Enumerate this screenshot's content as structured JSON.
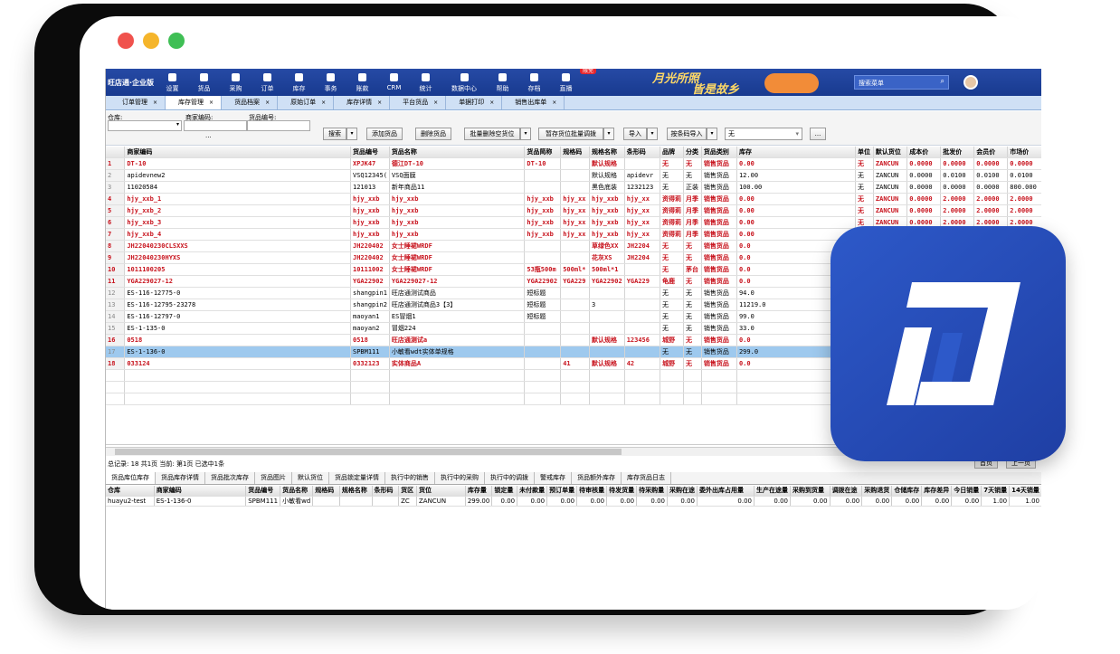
{
  "window": {
    "dot_colors": [
      "#f0524d",
      "#f5b52b",
      "#3fbf55"
    ]
  },
  "app": {
    "brand": "旺店通·企业版"
  },
  "nav": [
    "设置",
    "货品",
    "采购",
    "订单",
    "库存",
    "事务",
    "账款",
    "CRM",
    "统计",
    "数据中心",
    "帮助",
    "存档",
    "直播"
  ],
  "nav_badge": "限免",
  "banner": {
    "line1": "月光所照",
    "line2": "皆是故乡"
  },
  "search_placeholder": "搜索菜单",
  "tabs": [
    "订单管理",
    "库存管理",
    "货品档案",
    "原始订单",
    "库存详情",
    "平台货品",
    "单据打印",
    "销售出库单"
  ],
  "active_tab": 1,
  "filter": {
    "warehouse_label": "仓库:",
    "merchant_code_label": "商家编码:",
    "goods_code_label": "货品编号:",
    "more": "···"
  },
  "toolbar": {
    "search": "搜索",
    "add": "添加货品",
    "delete": "删除货品",
    "batch_delete_pos": "批量删除空货位",
    "temp_pos": "暂存货位批量调拨",
    "import": "导入",
    "barcode_import": "按条码导入",
    "select_value": "无",
    "ellipsis": "..."
  },
  "columns": [
    "",
    "商家编码",
    "货品编号",
    "货品名称",
    "货品简称",
    "规格码",
    "规格名称",
    "条形码",
    "品牌",
    "分类",
    "货品类别",
    "库存",
    "单位",
    "默认货位",
    "成本价",
    "批发价",
    "会员价",
    "市场价"
  ],
  "rows": [
    {
      "n": "1",
      "red": true,
      "c": [
        "DT-10",
        "XPJK47",
        "德江DT-10",
        "DT-10",
        "",
        "默认规格",
        "",
        "无",
        "无",
        "销售货品",
        "0.00",
        "无",
        "ZANCUN",
        "0.0000",
        "0.0000",
        "0.0000",
        "0.0000"
      ]
    },
    {
      "n": "2",
      "red": false,
      "c": [
        "apidevnew2",
        "VSQ12345(",
        "VSQ面膜",
        "",
        "",
        "默认规格",
        "apidevr",
        "无",
        "无",
        "销售货品",
        "12.00",
        "无",
        "ZANCUN",
        "0.0000",
        "0.0100",
        "0.0100",
        "0.0100"
      ]
    },
    {
      "n": "3",
      "red": false,
      "c": [
        "11020584",
        "121013",
        "新年商品11",
        "",
        "",
        "黑色底装",
        "1232123",
        "无",
        "正装",
        "销售货品",
        "100.00",
        "无",
        "ZANCUN",
        "0.0000",
        "0.0000",
        "0.0000",
        "800.000"
      ]
    },
    {
      "n": "4",
      "red": true,
      "c": [
        "hjy_xxb_1",
        "hjy_xxb",
        "hjy_xxb",
        "hjy_xxb",
        "hjy_xx",
        "hjy_xxb",
        "hjy_xx",
        "资得莉",
        "月季",
        "销售货品",
        "0.00",
        "无",
        "ZANCUN",
        "0.0000",
        "2.0000",
        "2.0000",
        "2.0000"
      ]
    },
    {
      "n": "5",
      "red": true,
      "c": [
        "hjy_xxb_2",
        "hjy_xxb",
        "hjy_xxb",
        "hjy_xxb",
        "hjy_xx",
        "hjy_xxb",
        "hjy_xx",
        "资得莉",
        "月季",
        "销售货品",
        "0.00",
        "无",
        "ZANCUN",
        "0.0000",
        "2.0000",
        "2.0000",
        "2.0000"
      ]
    },
    {
      "n": "6",
      "red": true,
      "c": [
        "hjy_xxb_3",
        "hjy_xxb",
        "hjy_xxb",
        "hjy_xxb",
        "hjy_xx",
        "hjy_xxb",
        "hjy_xx",
        "资得莉",
        "月季",
        "销售货品",
        "0.00",
        "无",
        "ZANCUN",
        "0.0000",
        "2.0000",
        "2.0000",
        "2.0000"
      ]
    },
    {
      "n": "7",
      "red": true,
      "c": [
        "hjy_xxb_4",
        "hjy_xxb",
        "hjy_xxb",
        "hjy_xxb",
        "hjy_xx",
        "hjy_xxb",
        "hjy_xx",
        "资得莉",
        "月季",
        "销售货品",
        "0.00",
        "无",
        "",
        "",
        "",
        "",
        ""
      ]
    },
    {
      "n": "8",
      "red": true,
      "c": [
        "JH22040230CLSXXS",
        "JH220402",
        "女士睡裙WRDF",
        "",
        "",
        "草绿色XX",
        "JH2204",
        "无",
        "无",
        "销售货品",
        "0.0",
        "",
        "",
        "",
        "",
        "",
        ""
      ]
    },
    {
      "n": "9",
      "red": true,
      "c": [
        "JH22040230HYXS",
        "JH220402",
        "女士睡裙WRDF",
        "",
        "",
        "花灰XS",
        "JH2204",
        "无",
        "无",
        "销售货品",
        "0.0",
        "",
        "",
        "",
        "",
        "",
        ""
      ]
    },
    {
      "n": "10",
      "red": true,
      "c": [
        "1011100205",
        "10111002",
        "女士睡裙WRDF",
        "53瓶500m",
        "500ml*",
        "500ml*1",
        "",
        "无",
        "茅台",
        "销售货品",
        "0.0",
        "",
        "",
        "",
        "",
        "",
        ""
      ]
    },
    {
      "n": "11",
      "red": true,
      "c": [
        "YGA229027-12",
        "YGA22902",
        "YGA229027-12",
        "YGA22902",
        "YGA229",
        "YGA22902",
        "YGA229",
        "龟鹿",
        "无",
        "销售货品",
        "0.0",
        "",
        "",
        "",
        "",
        "",
        ""
      ]
    },
    {
      "n": "12",
      "red": false,
      "c": [
        "ES-116-12775-0",
        "shangpin1",
        "旺店通测试商品",
        "短标题",
        "",
        "",
        "",
        "无",
        "无",
        "销售货品",
        "94.0",
        "",
        "",
        "",
        "",
        "",
        ""
      ]
    },
    {
      "n": "13",
      "red": false,
      "c": [
        "ES-116-12795-23278",
        "shangpin2",
        "旺店通测试商品3【3】",
        "短标题",
        "",
        "3",
        "",
        "无",
        "无",
        "销售货品",
        "11219.0",
        "",
        "",
        "",
        "",
        "",
        ""
      ]
    },
    {
      "n": "14",
      "red": false,
      "c": [
        "ES-116-12797-0",
        "maoyan1",
        "ES冒烟1",
        "短标题",
        "",
        "",
        "",
        "无",
        "无",
        "销售货品",
        "99.0",
        "",
        "",
        "",
        "",
        "",
        ""
      ]
    },
    {
      "n": "15",
      "red": false,
      "c": [
        "ES-1-135-0",
        "maoyan2",
        "冒烟224",
        "",
        "",
        "",
        "",
        "无",
        "无",
        "销售货品",
        "33.0",
        "",
        "",
        "",
        "",
        "",
        ""
      ]
    },
    {
      "n": "16",
      "red": true,
      "c": [
        "0518",
        "0518",
        "旺店通测试a",
        "",
        "",
        "默认规格",
        "123456",
        "城野",
        "无",
        "销售货品",
        "0.0",
        "",
        "",
        "",
        "",
        "",
        ""
      ]
    },
    {
      "n": "17",
      "red": false,
      "sel": true,
      "c": [
        "ES-1-136-0",
        "SPBM111",
        "小敏看wdt实体单规格",
        "",
        "",
        "",
        "",
        "无",
        "无",
        "销售货品",
        "299.0",
        "",
        "",
        "",
        "",
        "",
        ""
      ]
    },
    {
      "n": "18",
      "red": true,
      "c": [
        "033124",
        "0332123",
        "实体商品A",
        "",
        "41",
        "默认规格",
        "42",
        "城野",
        "无",
        "销售货品",
        "0.0",
        "",
        "",
        "",
        "",
        "",
        ""
      ]
    }
  ],
  "status": "总记录: 18  共1页  当前: 第1页  已选中1条",
  "pager": {
    "first": "首页",
    "prev": "上一页"
  },
  "bottom_tabs": [
    "货品库位库存",
    "货品库存详情",
    "货品批次库存",
    "货品图片",
    "默认货位",
    "货品锁定量详情",
    "执行中的销售",
    "执行中的采购",
    "执行中的调拨",
    "警戒库存",
    "货品额外库存",
    "库存货品日志"
  ],
  "bottom_columns": [
    "仓库",
    "商家编码",
    "货品编号",
    "货品名称",
    "规格码",
    "规格名称",
    "条形码",
    "货区",
    "货位",
    "库存量",
    "锁定量",
    "未付款量",
    "预订单量",
    "待审核量",
    "待发货量",
    "待采购量",
    "采购在途",
    "委外出库占用量",
    "生产在途量",
    "采购到货量",
    "调拨在途",
    "采购退货",
    "仓储库存",
    "库存差异",
    "今日销量",
    "7天销量",
    "14天销量"
  ],
  "bottom_row": [
    "huayu2-test",
    "ES-1-136-0",
    "SPBM111",
    "小敏看wd",
    "",
    "",
    "",
    "ZC",
    "ZANCUN",
    "299.00",
    "0.00",
    "0.00",
    "0.00",
    "0.00",
    "0.00",
    "0.00",
    "0.00",
    "0.00",
    "0.00",
    "0.00",
    "0.00",
    "0.00",
    "0.00",
    "0.00",
    "0.00",
    "1.00",
    "1.00"
  ]
}
